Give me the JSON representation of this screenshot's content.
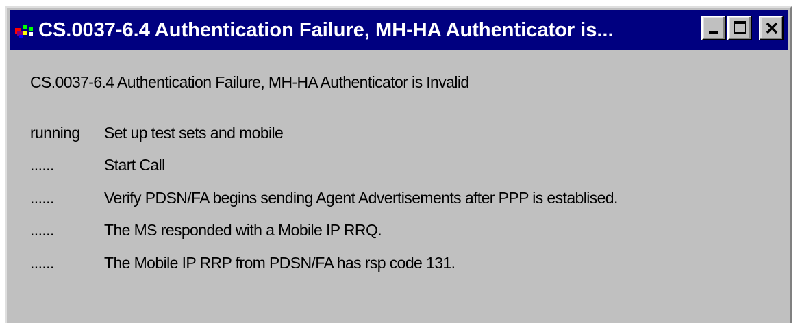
{
  "window": {
    "title": "CS.0037-6.4 Authentication Failure, MH-HA Authenticator is...",
    "controls": {
      "minimize": "minimize-icon",
      "maximize": "maximize-icon",
      "close": "close-icon"
    },
    "colors": {
      "titlebar": "#000080",
      "body": "#c0c0c0",
      "title_text": "#ffffff"
    }
  },
  "content": {
    "heading": "CS.0037-6.4 Authentication Failure, MH-HA Authenticator is Invalid",
    "steps": [
      {
        "status": "running",
        "text": "Set up test sets and mobile"
      },
      {
        "status": "......",
        "text": "Start Call"
      },
      {
        "status": "......",
        "text": "Verify PDSN/FA begins sending Agent Advertisements after PPP is establised."
      },
      {
        "status": "......",
        "text": "The MS responded with a Mobile IP RRQ."
      },
      {
        "status": "......",
        "text": "The Mobile IP RRP from PDSN/FA has rsp code 131."
      }
    ]
  }
}
